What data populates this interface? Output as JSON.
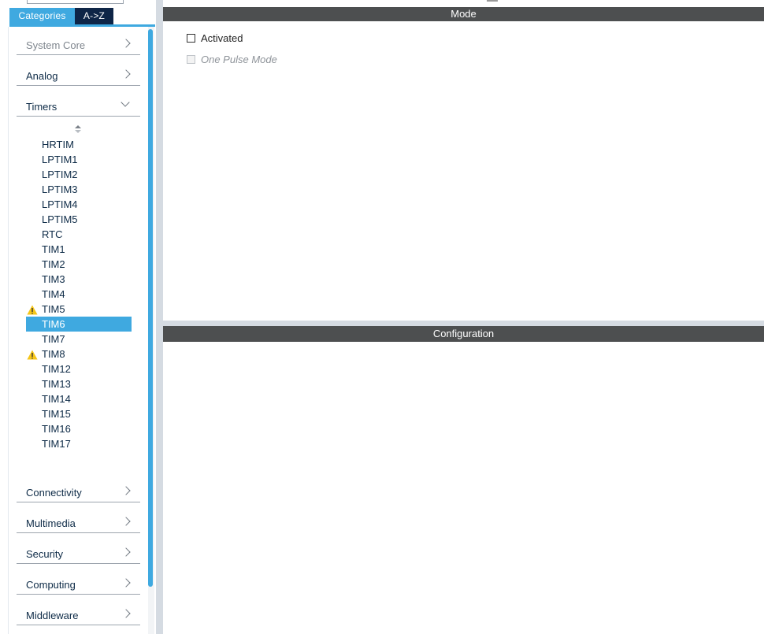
{
  "left_panel": {
    "tabs": {
      "categories": "Categories",
      "az": "A->Z"
    },
    "categories": [
      {
        "label": "System Core",
        "disabled": true
      },
      {
        "label": "Analog"
      },
      {
        "label": "Timers",
        "expanded": true
      },
      {
        "label": "Connectivity"
      },
      {
        "label": "Multimedia"
      },
      {
        "label": "Security"
      },
      {
        "label": "Computing"
      },
      {
        "label": "Middleware"
      }
    ],
    "timers": [
      {
        "label": "HRTIM"
      },
      {
        "label": "LPTIM1"
      },
      {
        "label": "LPTIM2"
      },
      {
        "label": "LPTIM3"
      },
      {
        "label": "LPTIM4"
      },
      {
        "label": "LPTIM5"
      },
      {
        "label": "RTC"
      },
      {
        "label": "TIM1"
      },
      {
        "label": "TIM2"
      },
      {
        "label": "TIM3"
      },
      {
        "label": "TIM4"
      },
      {
        "label": "TIM5",
        "warning": true
      },
      {
        "label": "TIM6",
        "selected": true
      },
      {
        "label": "TIM7"
      },
      {
        "label": "TIM8",
        "warning": true
      },
      {
        "label": "TIM12"
      },
      {
        "label": "TIM13"
      },
      {
        "label": "TIM14"
      },
      {
        "label": "TIM15"
      },
      {
        "label": "TIM16"
      },
      {
        "label": "TIM17"
      }
    ]
  },
  "mode_panel": {
    "title": "Mode",
    "options": [
      {
        "label": "Activated",
        "checked": false,
        "enabled": true
      },
      {
        "label": "One Pulse Mode",
        "checked": false,
        "enabled": false
      }
    ]
  },
  "config_panel": {
    "title": "Configuration"
  },
  "colors": {
    "accent": "#3fa9e0",
    "dark_tab": "#0e2547",
    "header_bg": "#4d4f50",
    "warning": "#f5c518"
  },
  "icons": {
    "expand": "chevron-right-icon",
    "collapse": "chevron-down-icon",
    "sort": "sort-icon",
    "warning": "warning-icon"
  }
}
